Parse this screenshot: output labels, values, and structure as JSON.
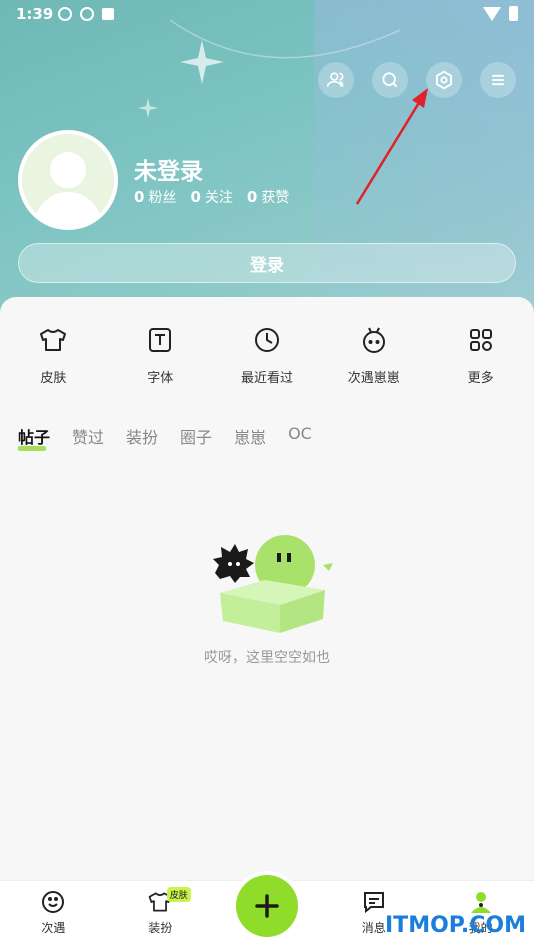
{
  "status_bar": {
    "time": "1:39"
  },
  "header": {
    "icons": [
      "contacts-icon",
      "search-icon",
      "settings-icon",
      "menu-icon"
    ]
  },
  "profile": {
    "username": "未登录",
    "fans_count": "0",
    "fans_label": "粉丝",
    "following_count": "0",
    "following_label": "关注",
    "likes_count": "0",
    "likes_label": "获赞",
    "login_label": "登录"
  },
  "quick_actions": [
    {
      "label": "皮肤",
      "icon": "shirt-icon"
    },
    {
      "label": "字体",
      "icon": "font-icon"
    },
    {
      "label": "最近看过",
      "icon": "clock-icon"
    },
    {
      "label": "次遇崽崽",
      "icon": "creature-icon"
    },
    {
      "label": "更多",
      "icon": "more-grid-icon"
    }
  ],
  "tabs": [
    {
      "label": "帖子",
      "active": true
    },
    {
      "label": "赞过"
    },
    {
      "label": "装扮"
    },
    {
      "label": "圈子"
    },
    {
      "label": "崽崽"
    },
    {
      "label": "OC"
    }
  ],
  "empty_state": {
    "text": "哎呀，这里空空如也"
  },
  "bottom_nav": [
    {
      "label": "次遇",
      "icon": "smile-icon"
    },
    {
      "label": "装扮",
      "icon": "shirt-icon",
      "badge": "皮肤"
    },
    {
      "label": "",
      "icon": "plus-icon"
    },
    {
      "label": "消息",
      "icon": "message-icon"
    },
    {
      "label": "我的",
      "icon": "profile-icon"
    }
  ],
  "watermark": "ITMOP.COM",
  "colors": {
    "accent_green": "#8fdd2a",
    "header_teal": "#7cc4c2",
    "arrow_red": "#e0202a"
  }
}
